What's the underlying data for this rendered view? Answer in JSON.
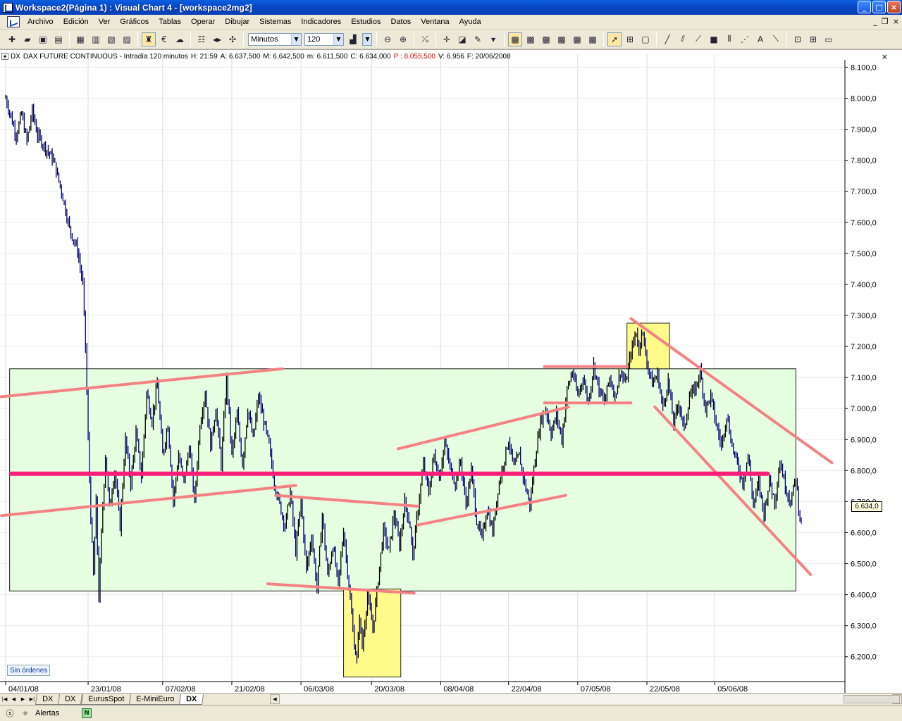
{
  "window": {
    "title": "Workspace2(Página 1) : Visual Chart 4 - [workspace2mg2]",
    "minimize_glyph": "_",
    "maximize_glyph": "□",
    "close_glyph": "×"
  },
  "menu": {
    "items": [
      "Archivo",
      "Edición",
      "Ver",
      "Gráficos",
      "Tablas",
      "Operar",
      "Dibujar",
      "Sistemas",
      "Indicadores",
      "Estudios",
      "Datos",
      "Ventana",
      "Ayuda"
    ],
    "mdi_glyphs": [
      "_",
      "❐",
      "×"
    ]
  },
  "toolbar": {
    "timeframe_unit": "Minutos",
    "timeframe_value": "120"
  },
  "chart_header": {
    "symbol": "DX",
    "description": "DAX FUTURE CONTINUOUS - Intradía 120 minutos",
    "h": "H: 21:59",
    "a": "A: 6.637,500",
    "m": "M: 6.642,500",
    "m2": "m: 6.611,500",
    "c": "C: 6.634,000",
    "p": "P : 8.055,500",
    "v": "V: 6.956",
    "f": "F: 20/06/2008"
  },
  "current_price_label": "6.634,0",
  "orders_badge": "Sin órdenes",
  "sheet_tabs": [
    {
      "label": "DX",
      "active": false
    },
    {
      "label": "DX",
      "active": false
    },
    {
      "label": "EurusSpot",
      "active": false
    },
    {
      "label": "E-MiniEuro",
      "active": false
    },
    {
      "label": "DX",
      "active": true
    }
  ],
  "status": {
    "alerts_label": "Alertas"
  },
  "colors": {
    "candle_up": "#000000",
    "candle_down": "#000080",
    "trendline": "#f38282",
    "support_line": "#ff1d7a",
    "range_box": "#e6ffe0",
    "highlight_box": "#fffb8a"
  },
  "chart_data": {
    "type": "candlestick",
    "title": "DAX FUTURE CONTINUOUS - Intradía 120 minutos",
    "y_ticks": [
      "8.100,0",
      "8.000,0",
      "7.900,0",
      "7.800,0",
      "7.700,0",
      "7.600,0",
      "7.500,0",
      "7.400,0",
      "7.300,0",
      "7.200,0",
      "7.100,0",
      "7.000,0",
      "6.900,0",
      "6.800,0",
      "6.700,0",
      "6.600,0",
      "6.500,0",
      "6.400,0",
      "6.300,0",
      "6.200,0"
    ],
    "y_tick_values": [
      8100,
      8000,
      7900,
      7800,
      7700,
      7600,
      7500,
      7400,
      7300,
      7200,
      7100,
      7000,
      6900,
      6800,
      6700,
      6600,
      6500,
      6400,
      6300,
      6200
    ],
    "ylim": [
      6120,
      8110
    ],
    "x_ticks": [
      "04/01/08",
      "23/01/08",
      "07/02/08",
      "21/02/08",
      "06/03/08",
      "20/03/08",
      "08/04/08",
      "22/04/08",
      "07/05/08",
      "22/05/08",
      "05/06/08"
    ],
    "x_tick_index": [
      0,
      62,
      118,
      170,
      222,
      275,
      327,
      378,
      430,
      482,
      533
    ],
    "n_bars": 600,
    "grid": true,
    "price_path": [
      [
        0,
        8000
      ],
      [
        8,
        7880
      ],
      [
        12,
        7950
      ],
      [
        16,
        7860
      ],
      [
        20,
        7960
      ],
      [
        24,
        7880
      ],
      [
        30,
        7840
      ],
      [
        36,
        7800
      ],
      [
        42,
        7700
      ],
      [
        48,
        7580
      ],
      [
        54,
        7510
      ],
      [
        58,
        7400
      ],
      [
        60,
        7200
      ],
      [
        62,
        6900
      ],
      [
        64,
        6650
      ],
      [
        66,
        6460
      ],
      [
        68,
        6700
      ],
      [
        70,
        6390
      ],
      [
        72,
        6600
      ],
      [
        75,
        6850
      ],
      [
        78,
        6680
      ],
      [
        82,
        6800
      ],
      [
        86,
        6620
      ],
      [
        90,
        6900
      ],
      [
        94,
        6760
      ],
      [
        98,
        6920
      ],
      [
        102,
        6780
      ],
      [
        106,
        7050
      ],
      [
        110,
        6960
      ],
      [
        114,
        7080
      ],
      [
        118,
        6850
      ],
      [
        122,
        6950
      ],
      [
        126,
        6700
      ],
      [
        130,
        6850
      ],
      [
        134,
        6760
      ],
      [
        138,
        6880
      ],
      [
        142,
        6700
      ],
      [
        146,
        6950
      ],
      [
        150,
        7050
      ],
      [
        154,
        6880
      ],
      [
        158,
        7000
      ],
      [
        162,
        6820
      ],
      [
        166,
        7100
      ],
      [
        170,
        6850
      ],
      [
        174,
        6980
      ],
      [
        178,
        6820
      ],
      [
        182,
        7000
      ],
      [
        186,
        6900
      ],
      [
        190,
        7040
      ],
      [
        194,
        6960
      ],
      [
        198,
        6880
      ],
      [
        202,
        6760
      ],
      [
        206,
        6690
      ],
      [
        210,
        6620
      ],
      [
        214,
        6730
      ],
      [
        218,
        6540
      ],
      [
        222,
        6700
      ],
      [
        226,
        6480
      ],
      [
        230,
        6590
      ],
      [
        234,
        6420
      ],
      [
        238,
        6660
      ],
      [
        242,
        6460
      ],
      [
        246,
        6560
      ],
      [
        250,
        6430
      ],
      [
        254,
        6610
      ],
      [
        258,
        6430
      ],
      [
        262,
        6240
      ],
      [
        264,
        6190
      ],
      [
        266,
        6330
      ],
      [
        268,
        6230
      ],
      [
        272,
        6400
      ],
      [
        276,
        6290
      ],
      [
        280,
        6450
      ],
      [
        284,
        6610
      ],
      [
        288,
        6540
      ],
      [
        292,
        6660
      ],
      [
        296,
        6560
      ],
      [
        300,
        6700
      ],
      [
        304,
        6620
      ],
      [
        306,
        6520
      ],
      [
        310,
        6680
      ],
      [
        314,
        6820
      ],
      [
        318,
        6730
      ],
      [
        322,
        6850
      ],
      [
        326,
        6780
      ],
      [
        330,
        6890
      ],
      [
        334,
        6810
      ],
      [
        338,
        6760
      ],
      [
        342,
        6830
      ],
      [
        346,
        6690
      ],
      [
        350,
        6800
      ],
      [
        354,
        6640
      ],
      [
        358,
        6580
      ],
      [
        362,
        6680
      ],
      [
        366,
        6600
      ],
      [
        370,
        6740
      ],
      [
        374,
        6820
      ],
      [
        378,
        6900
      ],
      [
        382,
        6810
      ],
      [
        386,
        6850
      ],
      [
        390,
        6760
      ],
      [
        394,
        6690
      ],
      [
        398,
        6840
      ],
      [
        402,
        6960
      ],
      [
        406,
        7000
      ],
      [
        410,
        6920
      ],
      [
        414,
        6980
      ],
      [
        418,
        6900
      ],
      [
        422,
        7060
      ],
      [
        426,
        7120
      ],
      [
        430,
        7040
      ],
      [
        434,
        7100
      ],
      [
        438,
        7020
      ],
      [
        442,
        7140
      ],
      [
        446,
        7060
      ],
      [
        450,
        7020
      ],
      [
        454,
        7100
      ],
      [
        458,
        7040
      ],
      [
        462,
        7120
      ],
      [
        466,
        7080
      ],
      [
        470,
        7180
      ],
      [
        474,
        7250
      ],
      [
        476,
        7180
      ],
      [
        478,
        7260
      ],
      [
        482,
        7150
      ],
      [
        486,
        7080
      ],
      [
        490,
        7110
      ],
      [
        494,
        7000
      ],
      [
        498,
        7090
      ],
      [
        502,
        6950
      ],
      [
        506,
        7020
      ],
      [
        510,
        6930
      ],
      [
        514,
        7040
      ],
      [
        518,
        7060
      ],
      [
        522,
        7120
      ],
      [
        526,
        7000
      ],
      [
        530,
        7040
      ],
      [
        534,
        6950
      ],
      [
        538,
        6880
      ],
      [
        542,
        6980
      ],
      [
        546,
        6880
      ],
      [
        550,
        6820
      ],
      [
        554,
        6760
      ],
      [
        558,
        6850
      ],
      [
        562,
        6690
      ],
      [
        566,
        6760
      ],
      [
        570,
        6660
      ],
      [
        574,
        6770
      ],
      [
        578,
        6700
      ],
      [
        582,
        6830
      ],
      [
        586,
        6750
      ],
      [
        590,
        6700
      ],
      [
        594,
        6780
      ],
      [
        596,
        6680
      ],
      [
        598,
        6634
      ]
    ],
    "annotations": {
      "range_box": {
        "x": [
          3,
          594
        ],
        "y": [
          6412,
          7128
        ]
      },
      "low_box": {
        "x": [
          254,
          297
        ],
        "y": [
          6135,
          6418
        ]
      },
      "high_box": {
        "x": [
          467,
          499
        ],
        "y": [
          7128,
          7275
        ]
      },
      "support_level": 6790,
      "trendlines": [
        [
          [
            -10,
            7035
          ],
          [
            208,
            7128
          ]
        ],
        [
          [
            -3,
            6655
          ],
          [
            218,
            6752
          ]
        ],
        [
          [
            203,
            6720
          ],
          [
            310,
            6685
          ]
        ],
        [
          [
            197,
            6435
          ],
          [
            307,
            6405
          ]
        ],
        [
          [
            295,
            6870
          ],
          [
            423,
            7005
          ]
        ],
        [
          [
            310,
            6625
          ],
          [
            421,
            6720
          ]
        ],
        [
          [
            405,
            7135
          ],
          [
            467,
            7135
          ]
        ],
        [
          [
            405,
            7018
          ],
          [
            470,
            7018
          ]
        ],
        [
          [
            470,
            7290
          ],
          [
            621,
            6825
          ]
        ],
        [
          [
            488,
            7005
          ],
          [
            605,
            6465
          ]
        ]
      ]
    }
  }
}
